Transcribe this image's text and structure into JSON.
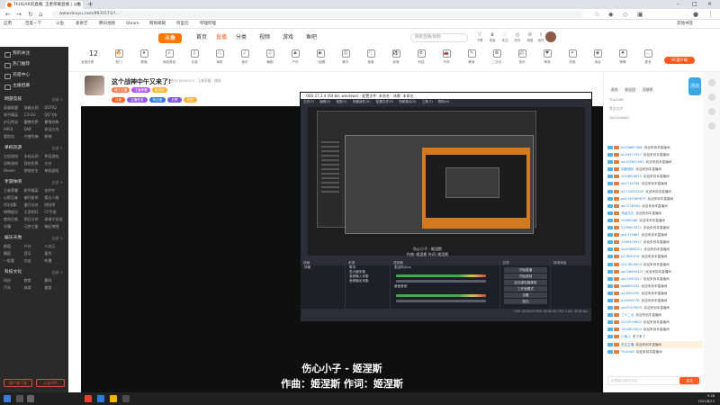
{
  "browser": {
    "tab_title": "ThUGAR的直播, 王者荣耀直播 | 斗鱼",
    "url": "www.douyu.com/8935573/?..."
  },
  "bookmarks": [
    "应用",
    "百度一下",
    "斗鱼",
    "爱奇艺",
    "腾讯视频",
    "Steam",
    "网易邮箱",
    "阿里云",
    "哔哩哔哩",
    "其他书签"
  ],
  "header": {
    "logo": "斗鱼",
    "nav": [
      "首页",
      "直播",
      "分类",
      "视频",
      "游戏",
      "鱼吧"
    ],
    "search_placeholder": "搜索直播/视频",
    "icons": [
      {
        "icon": "download-icon",
        "label": "下载"
      },
      {
        "icon": "crown-icon",
        "label": "贵族"
      },
      {
        "icon": "follow-icon",
        "label": "关注"
      },
      {
        "icon": "history-icon",
        "label": "历史"
      },
      {
        "icon": "message-icon",
        "label": "消息"
      },
      {
        "icon": "upload-icon",
        "label": "创作"
      }
    ]
  },
  "sidebar": {
    "top_items": [
      "我的关注",
      "热门推荐",
      "充值中心",
      "主播招募"
    ],
    "sections": [
      {
        "title": "网游竞技",
        "more": "全部 >",
        "items": [
          "英雄联盟",
          "穿越火线",
          "DOTA2",
          "和平精英",
          "CS:GO",
          "QQ飞车",
          "炉石传说",
          "魔兽世界",
          "暴雪经典",
          "APEX",
          "DNF",
          "命运方舟",
          "冒险岛",
          "守望先锋",
          "原神"
        ]
      },
      {
        "title": "单机热游",
        "more": "全部 >",
        "items": [
          "主机游戏",
          "永劫无间",
          "怀旧游戏",
          "恐怖游戏",
          "我的世界",
          "方舟",
          "Steam",
          "绝地求生",
          "单机游戏"
        ]
      },
      {
        "title": "手游休闲",
        "more": "全部 >",
        "items": [
          "王者荣耀",
          "和平精英",
          "金铲铲",
          "火影忍者",
          "崩坏星穹",
          "第五人格",
          "QQ炫舞",
          "蛋仔派对",
          "阴阳师",
          "棋牌娱乐",
          "天涯明月",
          "CF手游",
          "使命召唤",
          "明日方舟",
          "球球大作战",
          "光遇",
          "元梦之星",
          "暗区突围"
        ]
      },
      {
        "title": "娱乐天地",
        "more": "全部 >",
        "items": [
          "颜值",
          "户外",
          "二次元",
          "舞蹈",
          "音乐",
          "星秀",
          "一起看",
          "交友",
          "吃播"
        ]
      },
      {
        "title": "科技文化",
        "more": "全部 >",
        "items": [
          "科技",
          "教育",
          "数码",
          "汽车",
          "体育",
          "美食"
        ]
      }
    ],
    "footer_buttons": [
      "客户端下载",
      "斗鱼APP"
    ]
  },
  "categories": {
    "count": "12",
    "count_label": "全部分类",
    "items": [
      {
        "icon": "hot-icon",
        "label": "热门"
      },
      {
        "icon": "star-icon",
        "label": "颜值"
      },
      {
        "icon": "game-icon",
        "label": "网游竞技"
      },
      {
        "icon": "mobile-icon",
        "label": "手游"
      },
      {
        "icon": "console-icon",
        "label": "单机"
      },
      {
        "icon": "music-icon",
        "label": "音乐"
      },
      {
        "icon": "dance-icon",
        "label": "舞蹈"
      },
      {
        "icon": "outdoor-icon",
        "label": "户外"
      },
      {
        "icon": "movie-icon",
        "label": "一起看"
      },
      {
        "icon": "talk-icon",
        "label": "聊天"
      },
      {
        "icon": "food-icon",
        "label": "美食"
      },
      {
        "icon": "sport-icon",
        "label": "体育"
      },
      {
        "icon": "tech-icon",
        "label": "科技"
      },
      {
        "icon": "car-icon",
        "label": "汽车"
      },
      {
        "icon": "edu-icon",
        "label": "教育"
      },
      {
        "icon": "anime-icon",
        "label": "二次元"
      },
      {
        "icon": "news-icon",
        "label": "资讯"
      },
      {
        "icon": "pet-icon",
        "label": "萌宠"
      },
      {
        "icon": "fish-icon",
        "label": "钓鱼"
      },
      {
        "icon": "radio-icon",
        "label": "电台"
      },
      {
        "icon": "card-icon",
        "label": "棋牌"
      },
      {
        "icon": "more-icon",
        "label": "更多"
      }
    ],
    "pc_button": "PC客户端"
  },
  "room": {
    "title": "这个战神中午又来了!",
    "meta": "斗鱼ID 8935573 · 王者荣耀 · 播放",
    "tags": [
      {
        "text": "新人主播",
        "color": "#ff7a4e"
      },
      {
        "text": "王者荣耀",
        "color": "#b05ae6"
      },
      {
        "text": "技术流",
        "color": "#ffb22e"
      }
    ],
    "tags2": [
      {
        "text": "订阅",
        "color": "#ff5d23"
      },
      {
        "text": "主播任务",
        "color": "#8f5ae6"
      },
      {
        "text": "粉丝团",
        "color": "#2f79e0"
      },
      {
        "text": "分享",
        "color": "#7c5ad8"
      },
      {
        "text": "举报",
        "color": "#ffb22e"
      }
    ]
  },
  "obs": {
    "title": "OBS 27.2.4 (64-bit, windows) - 配置文件: 未命名 - 场景: 未命名",
    "menu": [
      "文件(F)",
      "编辑(E)",
      "视图(V)",
      "停靠部件(D)",
      "配置文件(P)",
      "场景集合(S)",
      "工具(T)",
      "帮助(H)"
    ],
    "caption_line1": "伤心小子 - 姬涅斯",
    "caption_line2": "作曲: 姬涅斯 作词: 姬涅斯",
    "docks": [
      "场景",
      "来源",
      "混音器",
      "转场特效",
      "控件"
    ],
    "scene_items": [
      "场景"
    ],
    "source_items": [
      "歌词",
      "显示器采集",
      "音频输入采集",
      "音频输出采集"
    ],
    "mixer_items": [
      "麦克风/Aux",
      "桌面音频"
    ],
    "controls": [
      "开始直播",
      "开始录制",
      "启动虚拟摄像机",
      "工作室模式",
      "设置",
      "退出"
    ],
    "status": "LIVE: 00:00:00   REC: 00:00:00   CPU: 1.8%, 30.00 fps"
  },
  "player": {
    "lyric_line1": "伤心小子 - 姬涅斯",
    "lyric_line2": "作曲：姬涅斯 作词：姬涅斯"
  },
  "chat": {
    "tabs": [
      "贵宾",
      "粉丝团",
      "贡献榜"
    ],
    "rank": [
      "ThUGAR",
      "鱼丸大户",
      "QAQUANAO"
    ],
    "promo": "活动",
    "lines": [
      {
        "user": "bUG8667368",
        "text": "欢迎来到本直播间"
      },
      {
        "user": "bu35977917",
        "text": "欢迎来到本直播间"
      },
      {
        "user": "wx105697483",
        "text": "欢迎来到本直播间"
      },
      {
        "user": "如影随形",
        "text": "欢迎来到本直播间"
      },
      {
        "user": "2016855873",
        "text": "欢迎来到本直播间"
      },
      {
        "user": "qq7134338",
        "text": "欢迎来到本直播间"
      },
      {
        "user": "q1712823303",
        "text": "欢迎来到本直播间"
      },
      {
        "user": "qq2143289873",
        "text": "欢迎来到本直播间"
      },
      {
        "user": "wx7278984",
        "text": "欢迎来到本直播间"
      },
      {
        "user": "鸿运当头",
        "text": "欢迎来到本直播间"
      },
      {
        "user": "20080988",
        "text": "欢迎来到本直播间"
      },
      {
        "user": "2139823472",
        "text": "欢迎来到本直播间"
      },
      {
        "user": "qq1374887",
        "text": "欢迎来到本直播间"
      },
      {
        "user": "2169423917",
        "text": "欢迎来到本直播间"
      },
      {
        "user": "wx00808221",
        "text": "欢迎来到本直播间"
      },
      {
        "user": "q27890019",
        "text": "欢迎来到本直播间"
      },
      {
        "user": "2017850834",
        "text": "欢迎来到本直播间"
      },
      {
        "user": "qq726892421",
        "text": "欢迎来到本直播间"
      },
      {
        "user": "qq72067017",
        "text": "欢迎来到本直播间"
      },
      {
        "user": "qq6800332",
        "text": "欢迎来到本直播间"
      },
      {
        "user": "q13020290",
        "text": "欢迎来到本直播间"
      },
      {
        "user": "q15098778",
        "text": "欢迎来到本直播间"
      },
      {
        "user": "wx97019870",
        "text": "欢迎来到本直播间"
      },
      {
        "user": "三十二点",
        "text": "欢迎来到本直播间"
      },
      {
        "user": "2019019802",
        "text": "欢迎来到本直播间"
      },
      {
        "user": "1903823004",
        "text": "欢迎来到本直播间"
      },
      {
        "user": "小鱼儿",
        "text": "来了来了"
      },
      {
        "user": "关注主播",
        "text": "欢迎来到本直播间",
        "special": true
      },
      {
        "user": "ThUGAR",
        "text": "欢迎来到本直播间"
      }
    ],
    "input_placeholder": "这里输入聊天内容",
    "send": "发送"
  },
  "taskbar": {
    "time": "9:36",
    "date": "2022/8/12"
  }
}
